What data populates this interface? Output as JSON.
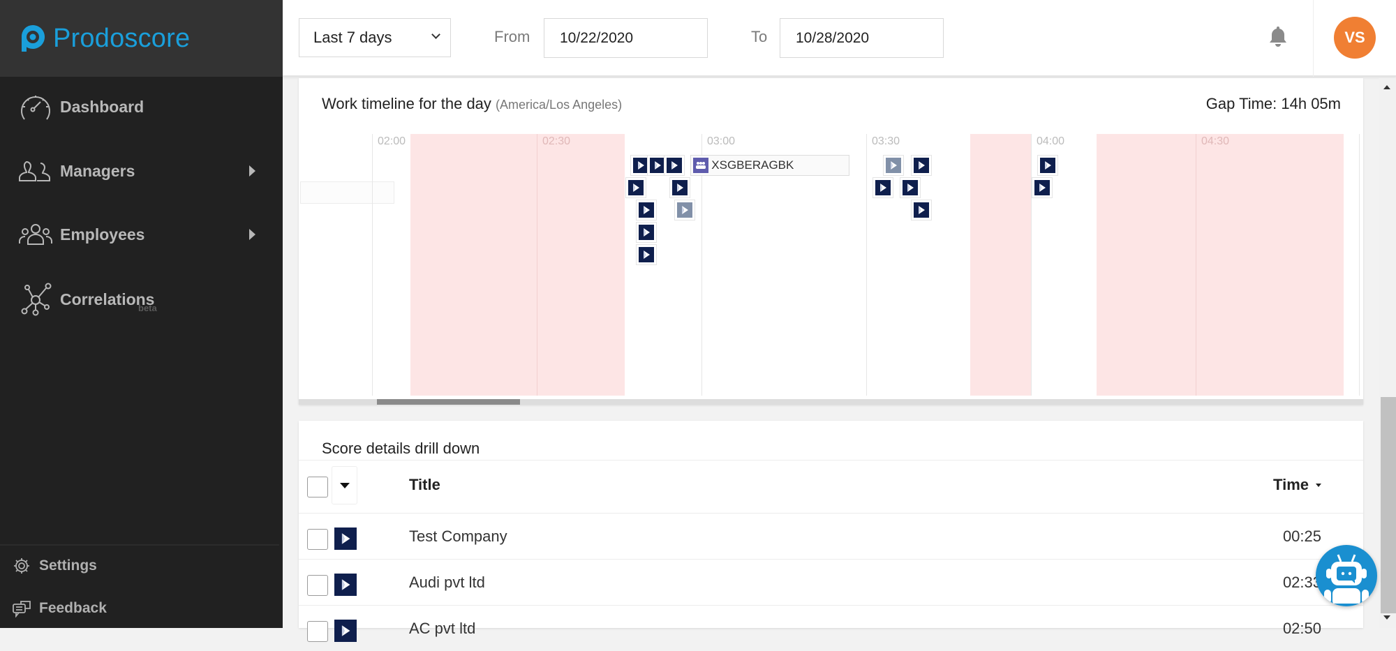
{
  "brand": {
    "name": "Prodoscore",
    "color": "#1a9fdb",
    "logo_icon": "prodoscore-logo-icon"
  },
  "sidebar": {
    "items": [
      {
        "label": "Dashboard",
        "icon": "speedometer-icon",
        "has_submenu": false
      },
      {
        "label": "Managers",
        "icon": "managers-icon",
        "has_submenu": true
      },
      {
        "label": "Employees",
        "icon": "employees-icon",
        "has_submenu": true
      },
      {
        "label": "Correlations",
        "icon": "network-icon",
        "has_submenu": false,
        "badge": "beta"
      }
    ],
    "footer": [
      {
        "label": "Settings",
        "icon": "gear-icon"
      },
      {
        "label": "Feedback",
        "icon": "chat-bubbles-icon"
      }
    ]
  },
  "header": {
    "range_select": {
      "value": "Last 7 days"
    },
    "from_label": "From",
    "from_value": "10/22/2020",
    "to_label": "To",
    "to_value": "10/28/2020",
    "notification_icon": "bell-icon",
    "avatar_initials": "VS",
    "avatar_color": "#f07f33"
  },
  "timeline": {
    "title": "Work timeline for the day",
    "timezone": "(America/Los Angeles)",
    "gap_time": "Gap Time: 14h 05m",
    "ticks": [
      "02:00",
      "02:30",
      "03:00",
      "03:30",
      "04:00",
      "04:30"
    ],
    "gaps": [
      {
        "start": "02:07",
        "end": "02:46"
      },
      {
        "start": "03:49",
        "end": "04:00"
      },
      {
        "start": "04:12",
        "end": "04:57"
      }
    ],
    "events": [
      {
        "type": "dynamics",
        "time": "02:49",
        "row": 0,
        "faded": false
      },
      {
        "type": "dynamics",
        "time": "02:52",
        "row": 0,
        "faded": false
      },
      {
        "type": "dynamics",
        "time": "02:55",
        "row": 0,
        "faded": false
      },
      {
        "type": "dynamics",
        "time": "02:48",
        "row": 1,
        "faded": false
      },
      {
        "type": "dynamics",
        "time": "02:56",
        "row": 1,
        "faded": false
      },
      {
        "type": "dynamics",
        "time": "02:50",
        "row": 2,
        "faded": false
      },
      {
        "type": "dynamics",
        "time": "02:57",
        "row": 2,
        "faded": true
      },
      {
        "type": "dynamics",
        "time": "02:50",
        "row": 3,
        "faded": false
      },
      {
        "type": "dynamics",
        "time": "02:50",
        "row": 4,
        "faded": false
      },
      {
        "type": "dynamics",
        "time": "03:35",
        "row": 0,
        "faded": true
      },
      {
        "type": "dynamics",
        "time": "03:40",
        "row": 0,
        "faded": false
      },
      {
        "type": "dynamics",
        "time": "03:33",
        "row": 1,
        "faded": false
      },
      {
        "type": "dynamics",
        "time": "03:38",
        "row": 1,
        "faded": false
      },
      {
        "type": "dynamics",
        "time": "03:40",
        "row": 2,
        "faded": false
      },
      {
        "type": "dynamics",
        "time": "04:03",
        "row": 0,
        "faded": false
      },
      {
        "type": "dynamics",
        "time": "04:02",
        "row": 1,
        "faded": false
      }
    ],
    "meeting": {
      "label": "XSGBERAGBK",
      "icon": "teams-meeting-icon",
      "start": "02:58",
      "end": "03:27",
      "row": 0
    },
    "scroll_position": 0.07
  },
  "table": {
    "title": "Score details drill down",
    "columns": {
      "title": "Title",
      "time": "Time"
    },
    "rows": [
      {
        "title": "Test Company",
        "time": "00:25",
        "icon": "dynamics-icon"
      },
      {
        "title": "Audi pvt ltd",
        "time": "02:33",
        "icon": "dynamics-icon"
      },
      {
        "title": "AC pvt ltd",
        "time": "02:50",
        "icon": "dynamics-icon"
      }
    ]
  },
  "chatbot": {
    "icon": "chatbot-robot-icon",
    "color": "#1a8fd0"
  }
}
